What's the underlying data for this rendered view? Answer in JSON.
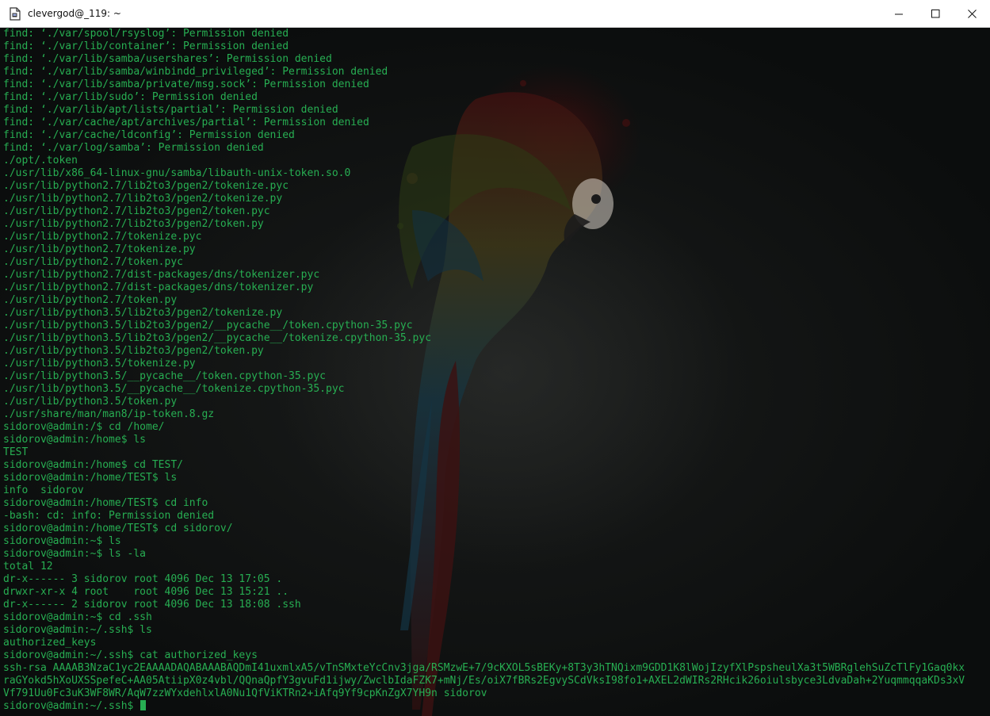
{
  "window": {
    "title": "clevergod@_119: ~",
    "app_icon": "putty-document-icon",
    "controls": {
      "minimize_icon": "minimize-icon",
      "maximize_icon": "maximize-icon",
      "close_icon": "close-icon"
    }
  },
  "colors": {
    "terminal_text": "#27ae52",
    "terminal_background": "#0b0d0d",
    "titlebar_background": "#ffffff"
  },
  "terminal": {
    "lines": [
      "find: ‘./var/spool/rsyslog’: Permission denied",
      "find: ‘./var/lib/container’: Permission denied",
      "find: ‘./var/lib/samba/usershares’: Permission denied",
      "find: ‘./var/lib/samba/winbindd_privileged’: Permission denied",
      "find: ‘./var/lib/samba/private/msg.sock’: Permission denied",
      "find: ‘./var/lib/sudo’: Permission denied",
      "find: ‘./var/lib/apt/lists/partial’: Permission denied",
      "find: ‘./var/cache/apt/archives/partial’: Permission denied",
      "find: ‘./var/cache/ldconfig’: Permission denied",
      "find: ‘./var/log/samba’: Permission denied",
      "./opt/.token",
      "./usr/lib/x86_64-linux-gnu/samba/libauth-unix-token.so.0",
      "./usr/lib/python2.7/lib2to3/pgen2/tokenize.pyc",
      "./usr/lib/python2.7/lib2to3/pgen2/tokenize.py",
      "./usr/lib/python2.7/lib2to3/pgen2/token.pyc",
      "./usr/lib/python2.7/lib2to3/pgen2/token.py",
      "./usr/lib/python2.7/tokenize.pyc",
      "./usr/lib/python2.7/tokenize.py",
      "./usr/lib/python2.7/token.pyc",
      "./usr/lib/python2.7/dist-packages/dns/tokenizer.pyc",
      "./usr/lib/python2.7/dist-packages/dns/tokenizer.py",
      "./usr/lib/python2.7/token.py",
      "./usr/lib/python3.5/lib2to3/pgen2/tokenize.py",
      "./usr/lib/python3.5/lib2to3/pgen2/__pycache__/token.cpython-35.pyc",
      "./usr/lib/python3.5/lib2to3/pgen2/__pycache__/tokenize.cpython-35.pyc",
      "./usr/lib/python3.5/lib2to3/pgen2/token.py",
      "./usr/lib/python3.5/tokenize.py",
      "./usr/lib/python3.5/__pycache__/token.cpython-35.pyc",
      "./usr/lib/python3.5/__pycache__/tokenize.cpython-35.pyc",
      "./usr/lib/python3.5/token.py",
      "./usr/share/man/man8/ip-token.8.gz",
      "sidorov@admin:/$ cd /home/",
      "sidorov@admin:/home$ ls",
      "TEST",
      "sidorov@admin:/home$ cd TEST/",
      "sidorov@admin:/home/TEST$ ls",
      "info  sidorov",
      "sidorov@admin:/home/TEST$ cd info",
      "-bash: cd: info: Permission denied",
      "sidorov@admin:/home/TEST$ cd sidorov/",
      "sidorov@admin:~$ ls",
      "sidorov@admin:~$ ls -la",
      "total 12",
      "dr-x------ 3 sidorov root 4096 Dec 13 17:05 .",
      "drwxr-xr-x 4 root    root 4096 Dec 13 15:21 ..",
      "dr-x------ 2 sidorov root 4096 Dec 13 18:08 .ssh",
      "sidorov@admin:~$ cd .ssh",
      "sidorov@admin:~/.ssh$ ls",
      "authorized_keys",
      "sidorov@admin:~/.ssh$ cat authorized_keys",
      "ssh-rsa AAAAB3NzaC1yc2EAAAADAQABAAABAQDmI41uxmlxA5/vTnSMxteYcCnv3jga/RSMzwE+7/9cKXOL5sBEKy+8T3y3hTNQixm9GDD1K8lWojIzyfXlPspsheulXa3t5WBRglehSuZcTlFy1Gaq0kx",
      "raGYokd5hXoUXSSpefeC+AA05AtiipX0z4vbl/QQnaQpfY3gvuFd1ijwy/ZwclbIdaFZK7+mNj/Es/oiX7fBRs2EgvySCdVksI98fo1+AXEL2dWIRs2RHcik26oiulsbyce3LdvaDah+2YuqmmqqaKDs3xV",
      "Vf791Uu0Fc3uK3WF8WR/AqW7zzWYxdehlxlA0Nu1QfViKTRn2+iAfq9Yf9cpKnZgX7YH9n sidorov",
      "sidorov@admin:~/.ssh$ "
    ]
  }
}
